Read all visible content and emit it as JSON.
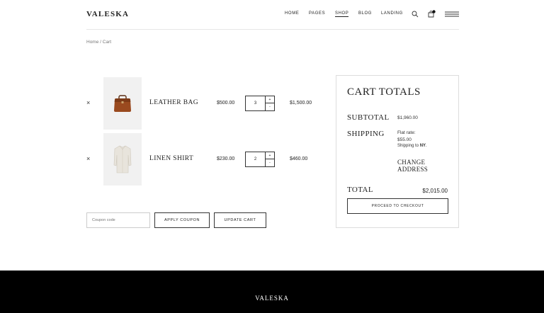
{
  "header": {
    "logo": "VALESKA",
    "nav": [
      "HOME",
      "PAGES",
      "SHOP",
      "BLOG",
      "LANDING"
    ],
    "active_nav": "SHOP",
    "cart_count": "0"
  },
  "breadcrumb": "Home / Cart",
  "cart": {
    "items": [
      {
        "remove": "×",
        "name": "LEATHER BAG",
        "price": "$500.00",
        "qty": "3",
        "subtotal": "$1,500.00",
        "image": "bag"
      },
      {
        "remove": "×",
        "name": "LINEN SHIRT",
        "price": "$230.00",
        "qty": "2",
        "subtotal": "$460.00",
        "image": "shirt"
      }
    ],
    "qty_up": "+",
    "qty_down": "-"
  },
  "coupon": {
    "placeholder": "Coupon code",
    "apply_label": "APPLY COUPON",
    "update_label": "UPDATE CART"
  },
  "totals": {
    "title": "CART TOTALS",
    "subtotal_label": "SUBTOTAL",
    "subtotal_value": "$1,960.00",
    "shipping_label": "SHIPPING",
    "shipping_method": "Flat rate:",
    "shipping_cost": "$55.00",
    "shipping_to_prefix": "Shipping to ",
    "shipping_to": "NY",
    "shipping_to_suffix": ".",
    "change_address": "CHANGE ADDRESS",
    "total_label": "TOTAL",
    "total_value": "$2,015.00",
    "checkout_label": "PROCEED TO CHECKOUT"
  },
  "footer": {
    "logo": "VALESKA"
  }
}
